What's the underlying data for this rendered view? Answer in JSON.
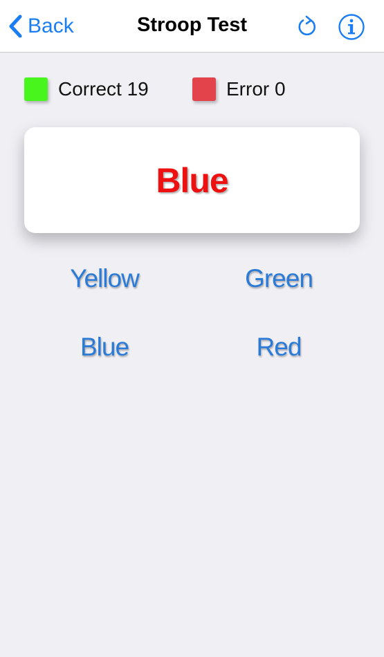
{
  "navbar": {
    "back_label": "Back",
    "title": "Stroop Test",
    "back_icon": "chevron-left-icon",
    "refresh_icon": "refresh-icon",
    "info_icon": "info-icon"
  },
  "score": {
    "correct_label": "Correct 19",
    "error_label": "Error 0"
  },
  "stimulus": {
    "word": "Blue",
    "ink_color": "#ee1111"
  },
  "answers": [
    {
      "label": "Yellow"
    },
    {
      "label": "Green"
    },
    {
      "label": "Blue"
    },
    {
      "label": "Red"
    }
  ],
  "colors": {
    "accent": "#1a7ef2",
    "answer_text": "#2a7bd8",
    "correct_swatch": "#48f51c",
    "error_swatch": "#e3434a",
    "background": "#efeff4"
  }
}
